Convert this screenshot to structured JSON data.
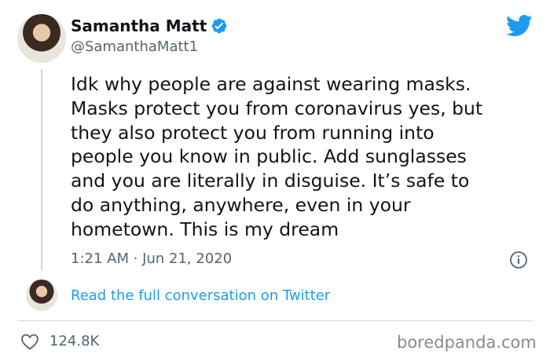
{
  "author": {
    "name": "Samantha Matt",
    "handle": "@SamanthaMatt1",
    "verified": true
  },
  "tweet": {
    "lines": [
      "Idk why people are against wearing masks.",
      "Masks protect you from coronavirus yes, but",
      "they also protect you from running into",
      "people you know in public. Add sunglasses",
      "and you are literally in disguise. It’s safe to",
      "do anything, anywhere, even in your",
      "hometown. This is my dream"
    ],
    "timestamp": "1:21 AM · Jun 21, 2020"
  },
  "conversation_link": "Read the full conversation on Twitter",
  "likes": "124.8K",
  "watermark": "boredpanda.com",
  "colors": {
    "twitter_blue": "#1d9bf0",
    "text": "#0f1419",
    "muted": "#536471"
  },
  "icons": [
    "verified-badge-icon",
    "twitter-bird-icon",
    "info-icon",
    "heart-icon"
  ]
}
